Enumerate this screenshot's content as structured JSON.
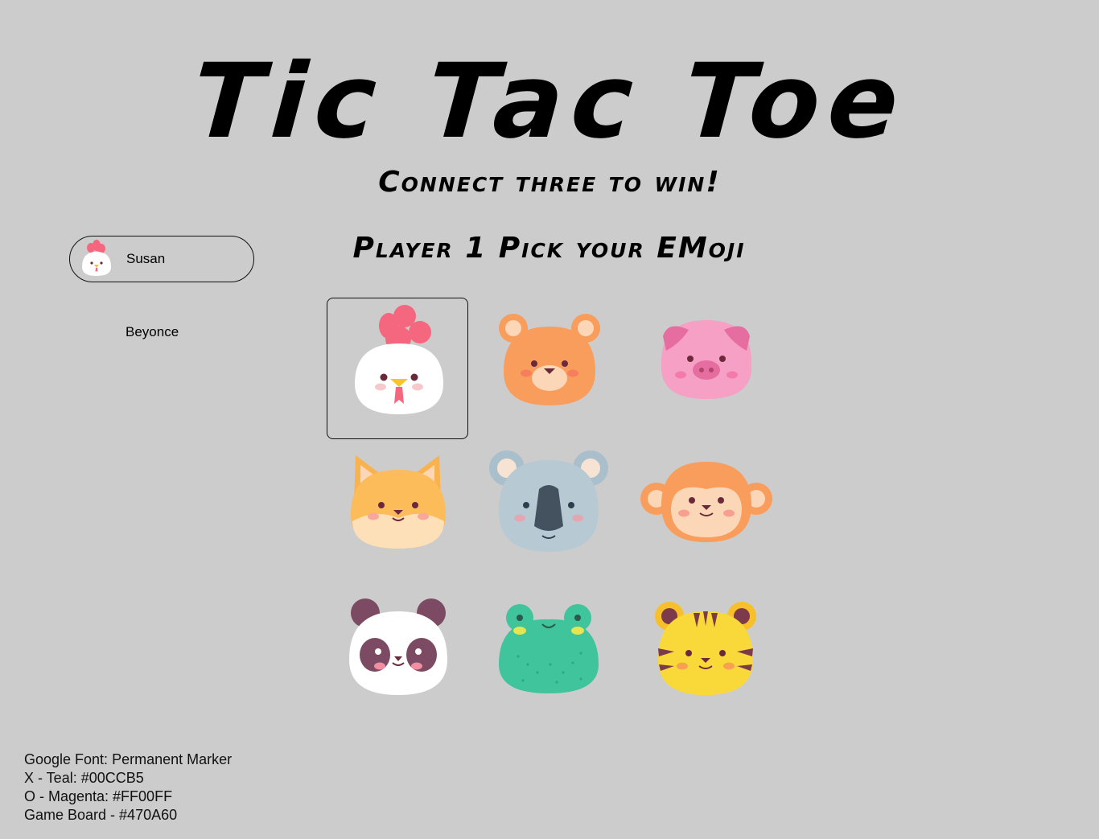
{
  "title": "Tic Tac Toe",
  "subtitle": "Connect three to win!",
  "pick_heading": "Player 1 Pick your EMoji",
  "players": [
    {
      "name": "Susan",
      "avatar": "chicken-icon",
      "active": true
    },
    {
      "name": "Beyonce",
      "avatar": "",
      "active": false
    }
  ],
  "emojis": [
    {
      "name": "chicken-icon",
      "selected": true
    },
    {
      "name": "bear-icon",
      "selected": false
    },
    {
      "name": "pig-icon",
      "selected": false
    },
    {
      "name": "fox-icon",
      "selected": false
    },
    {
      "name": "koala-icon",
      "selected": false
    },
    {
      "name": "monkey-icon",
      "selected": false
    },
    {
      "name": "panda-icon",
      "selected": false
    },
    {
      "name": "frog-icon",
      "selected": false
    },
    {
      "name": "tiger-icon",
      "selected": false
    }
  ],
  "notes": [
    "Google Font: Permanent Marker",
    "X - Teal: #00CCB5",
    "O - Magenta: #FF00FF",
    "Game Board - #470A60"
  ],
  "colors": {
    "background": "#cccccc",
    "x_teal": "#00CCB5",
    "o_magenta": "#FF00FF",
    "game_board": "#470A60"
  }
}
